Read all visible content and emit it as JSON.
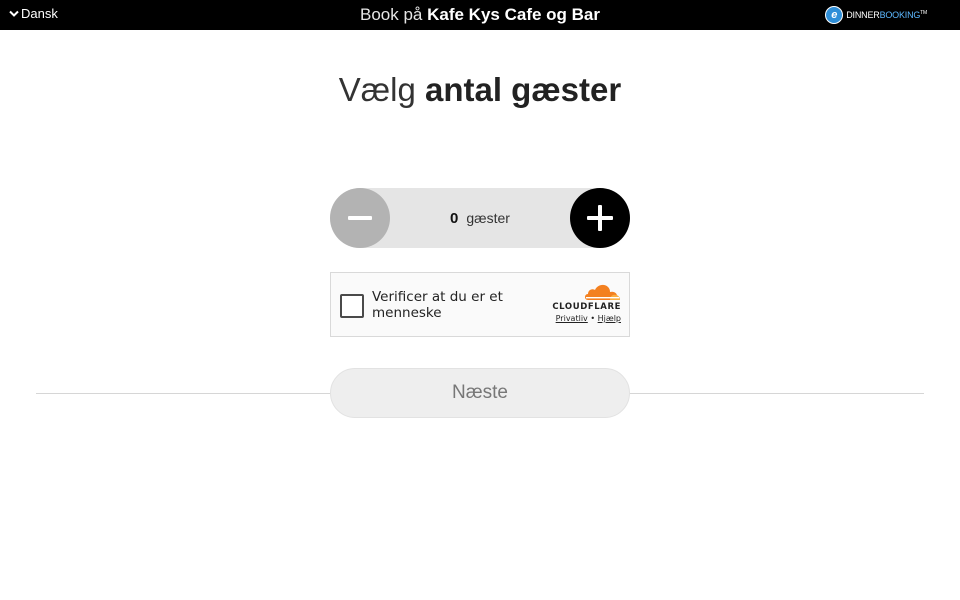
{
  "topbar": {
    "language_label": "Dansk",
    "title_prefix": "Book på",
    "restaurant_name": "Kafe Kys Cafe og Bar",
    "provider_logo": {
      "icon": "dinnerbooking-logo-icon",
      "word_part1": "DINNER",
      "word_part2": "BOOKING",
      "trademark": "TM"
    }
  },
  "heading": {
    "light": "Vælg",
    "bold": "antal gæster"
  },
  "guest_stepper": {
    "value": "0",
    "unit": "gæster",
    "minus_icon": "minus-icon",
    "plus_icon": "plus-icon"
  },
  "captcha": {
    "label": "Verificer at du er et menneske",
    "brand": "CLOUDFLARE",
    "privacy_link": "Privatliv",
    "separator": "•",
    "help_link": "Hjælp",
    "checked": false
  },
  "next_button": {
    "label": "Næste"
  },
  "colors": {
    "topbar_bg": "#000000",
    "stepper_bg": "#e5e5e5",
    "minus_bg": "#b3b3b3",
    "plus_bg": "#000000",
    "cloudflare_orange": "#f38020",
    "next_bg": "#eeeeee"
  }
}
